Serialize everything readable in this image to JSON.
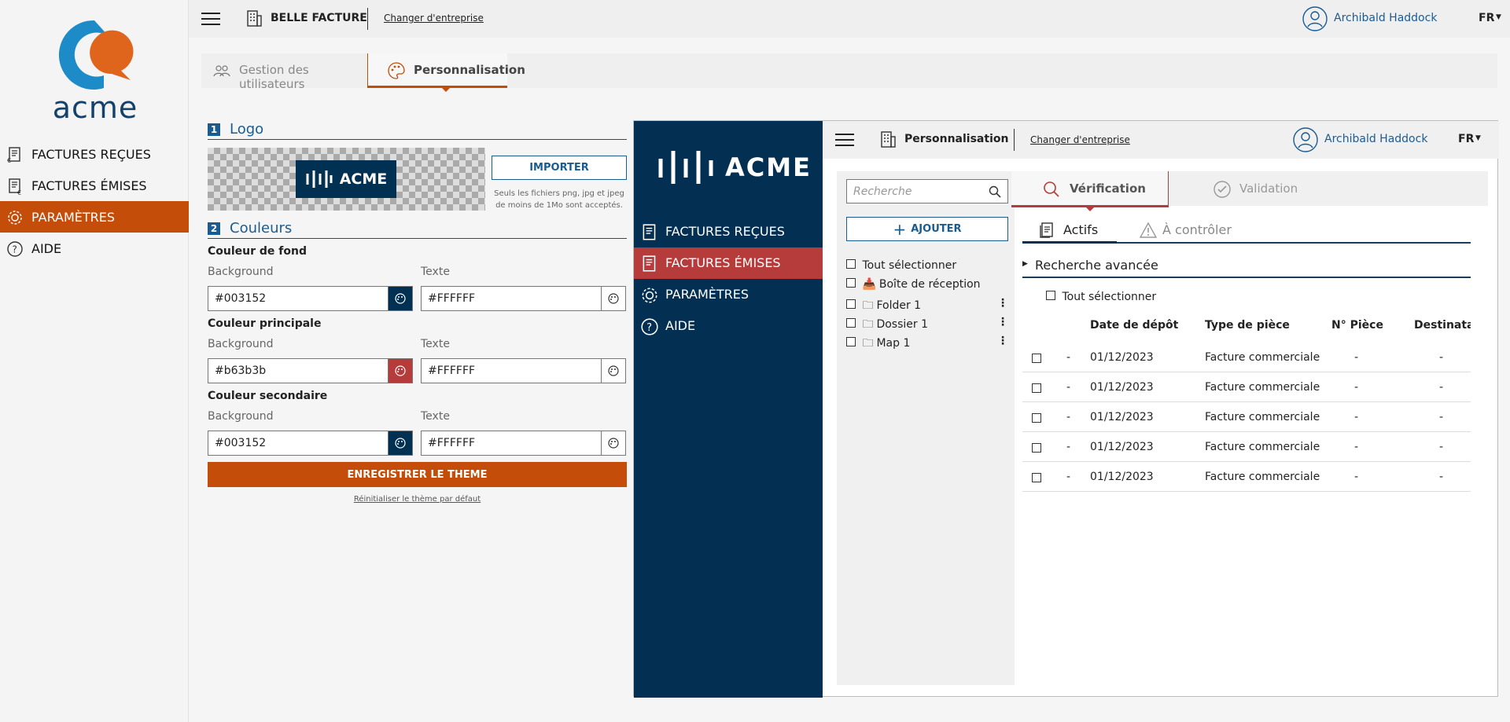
{
  "app": {
    "logo_text": "acme",
    "company": "BELLE FACTURE",
    "change_company": "Changer d'entreprise",
    "user": "Archibald Haddock",
    "lang": "FR"
  },
  "sidebar": {
    "items": [
      {
        "label": "FACTURES REÇUES",
        "icon": "invoice-received-icon"
      },
      {
        "label": "FACTURES ÉMISES",
        "icon": "invoice-sent-icon"
      },
      {
        "label": "PARAMÈTRES",
        "icon": "gear-icon",
        "active": true
      },
      {
        "label": "AIDE",
        "icon": "help-icon"
      }
    ]
  },
  "tabs": [
    {
      "label": "Gestion des utilisateurs",
      "icon": "users-icon"
    },
    {
      "label": "Personnalisation",
      "icon": "palette-icon",
      "active": true
    }
  ],
  "form": {
    "logo_section": {
      "num": "1",
      "title": "Logo",
      "preview_text": "ACME",
      "import_button": "IMPORTER",
      "hint": "Seuls les fichiers png, jpg et jpeg de moins de 1Mo sont acceptés."
    },
    "colors_section": {
      "num": "2",
      "title": "Couleurs"
    },
    "groups": [
      {
        "title": "Couleur de fond",
        "bg_label": "Background",
        "text_label": "Texte",
        "bg_value": "#003152",
        "text_value": "#FFFFFF",
        "bg_swatch": "#003152",
        "text_swatch": "#FFFFFF"
      },
      {
        "title": "Couleur principale",
        "bg_label": "Background",
        "text_label": "Texte",
        "bg_value": "#b63b3b",
        "text_value": "#FFFFFF",
        "bg_swatch": "#b63b3b",
        "text_swatch": "#FFFFFF"
      },
      {
        "title": "Couleur secondaire",
        "bg_label": "Background",
        "text_label": "Texte",
        "bg_value": "#003152",
        "text_value": "#FFFFFF",
        "bg_swatch": "#003152",
        "text_swatch": "#FFFFFF"
      }
    ],
    "save_button": "ENREGISTRER LE THEME",
    "reset_link": "Réinitialiser le thème par défaut"
  },
  "preview": {
    "logo_text": "ACME",
    "page_title": "Personnalisation",
    "change_company": "Changer d'entreprise",
    "user": "Archibald Haddock",
    "lang": "FR",
    "nav": [
      {
        "label": "FACTURES REÇUES",
        "icon": "invoice-received-icon"
      },
      {
        "label": "FACTURES ÉMISES",
        "icon": "invoice-sent-icon",
        "active": true
      },
      {
        "label": "PARAMÈTRES",
        "icon": "gear-icon"
      },
      {
        "label": "AIDE",
        "icon": "help-icon"
      }
    ],
    "search_placeholder": "Recherche",
    "add_button": "AJOUTER",
    "tree": {
      "select_all": "Tout sélectionner",
      "items": [
        "Boîte de réception",
        "Folder 1",
        "Dossier 1",
        "Map 1"
      ]
    },
    "stage_tabs": [
      {
        "label": "Vérification",
        "active": true
      },
      {
        "label": "Validation"
      }
    ],
    "sub_tabs": [
      {
        "label": "Actifs",
        "active": true
      },
      {
        "label": "À contrôler"
      }
    ],
    "advanced_search": "Recherche avancée",
    "table": {
      "select_all": "Tout sélectionner",
      "columns": [
        "Date de dépôt",
        "Type de pièce",
        "N° Pièce",
        "Destinatai"
      ],
      "rows": [
        [
          "-",
          "01/12/2023",
          "Facture commerciale",
          "-",
          "-"
        ],
        [
          "-",
          "01/12/2023",
          "Facture commerciale",
          "-",
          "-"
        ],
        [
          "-",
          "01/12/2023",
          "Facture commerciale",
          "-",
          "-"
        ],
        [
          "-",
          "01/12/2023",
          "Facture commerciale",
          "-",
          "-"
        ],
        [
          "-",
          "01/12/2023",
          "Facture commerciale",
          "-",
          "-"
        ]
      ]
    }
  },
  "colors": {
    "accent": "#c44d09",
    "brand_blue": "#14426c",
    "preview_bg": "#003152",
    "preview_primary": "#b63b3b"
  }
}
